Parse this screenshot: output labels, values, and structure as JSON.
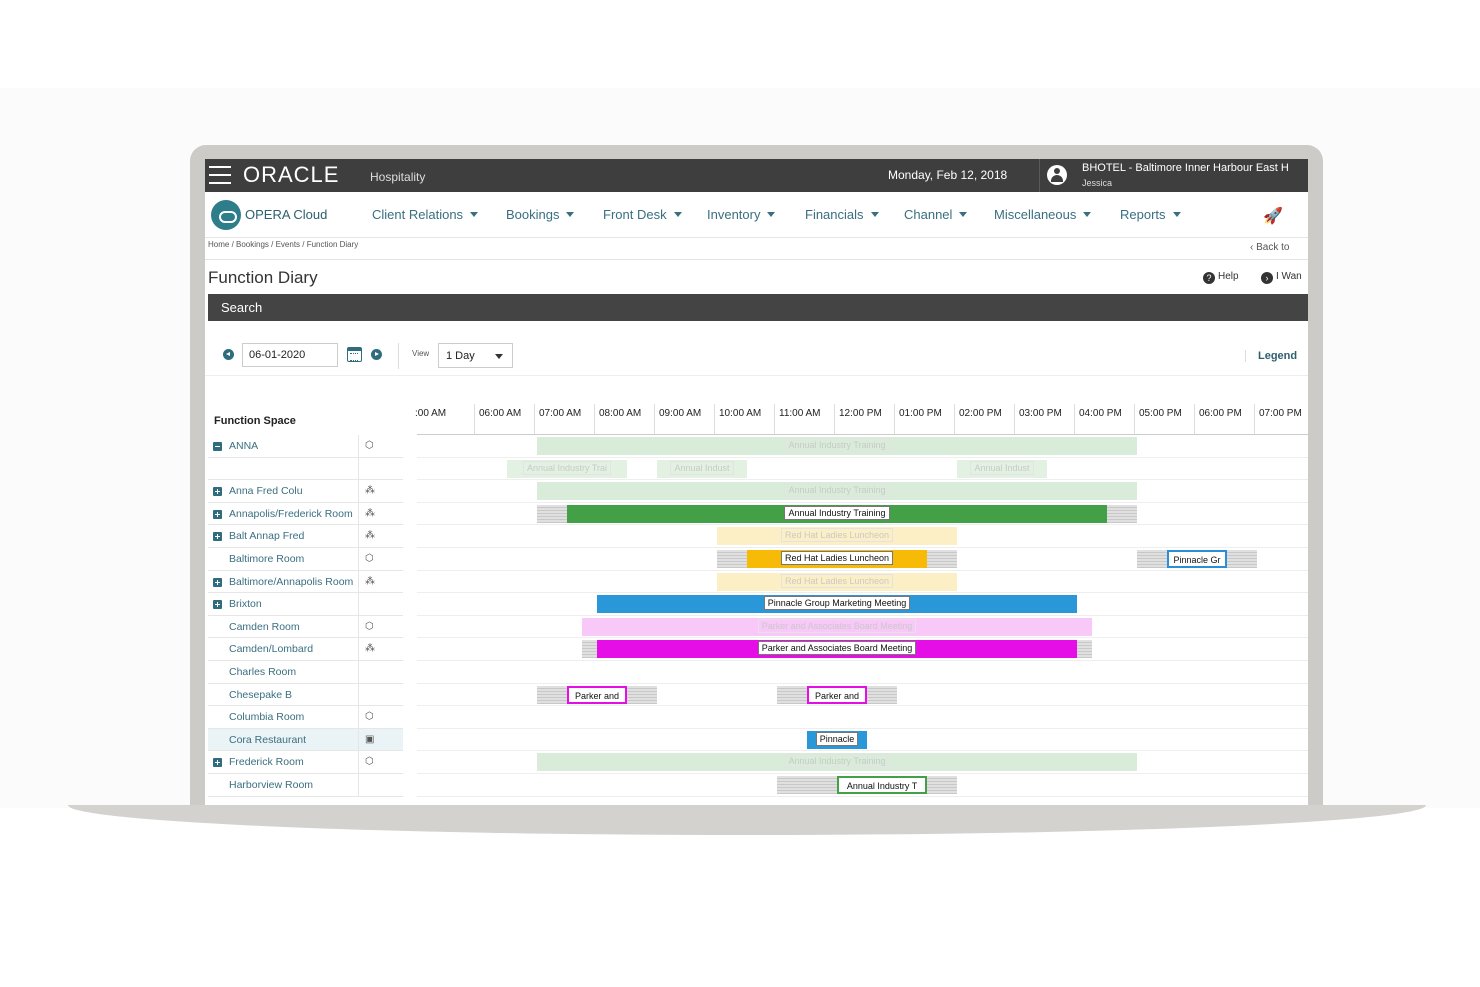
{
  "topbar": {
    "brand": "ORACLE",
    "brand_sub": "Hospitality",
    "date": "Monday, Feb 12, 2018",
    "hotel": "BHOTEL - Baltimore Inner Harbour East H",
    "user": "Jessica"
  },
  "nav": {
    "app": "OPERA Cloud",
    "menus": [
      "Client Relations",
      "Bookings",
      "Front Desk",
      "Inventory",
      "Financials",
      "Channel",
      "Miscellaneous",
      "Reports"
    ]
  },
  "breadcrumb": "Home / Bookings / Events / Function Diary",
  "back_link": "Back to",
  "page": {
    "title": "Function Diary",
    "help": "Help",
    "i_want": "I Wan"
  },
  "search": {
    "label": "Search",
    "date_value": "06-01-2020",
    "view_label": "View",
    "view_value": "1 Day",
    "legend": "Legend"
  },
  "diary": {
    "function_space_header": "Function Space",
    "times": [
      ":00 AM",
      "06:00 AM",
      "07:00 AM",
      "08:00 AM",
      "09:00 AM",
      "10:00 AM",
      "11:00 AM",
      "12:00 PM",
      "01:00 PM",
      "02:00 PM",
      "03:00 PM",
      "04:00 PM",
      "05:00 PM",
      "06:00 PM",
      "07:00 PM"
    ],
    "rooms": [
      {
        "name": "ANNA",
        "expander": "minus",
        "icon": "cube-icon"
      },
      {
        "name": "",
        "expander": "",
        "icon": ""
      },
      {
        "name": "Anna Fred Colu",
        "expander": "plus",
        "icon": "combo-icon"
      },
      {
        "name": "Annapolis/Frederick Room",
        "expander": "plus",
        "icon": "combo-icon"
      },
      {
        "name": "Balt Annap Fred",
        "expander": "plus",
        "icon": "combo-icon"
      },
      {
        "name": "Baltimore Room",
        "expander": "",
        "icon": "cube-icon"
      },
      {
        "name": "Baltimore/Annapolis Room",
        "expander": "plus",
        "icon": "combo-icon"
      },
      {
        "name": "Brixton",
        "expander": "plus",
        "icon": ""
      },
      {
        "name": "Camden Room",
        "expander": "",
        "icon": "cube-icon"
      },
      {
        "name": "Camden/Lombard",
        "expander": "",
        "icon": "combo-icon"
      },
      {
        "name": "Charles Room",
        "expander": "",
        "icon": ""
      },
      {
        "name": "Chesepake B",
        "expander": "",
        "icon": ""
      },
      {
        "name": "Columbia Room",
        "expander": "",
        "icon": "cube-icon"
      },
      {
        "name": "Cora Restaurant",
        "expander": "",
        "icon": "restaurant-icon"
      },
      {
        "name": "Frederick Room",
        "expander": "plus",
        "icon": "cube-icon"
      },
      {
        "name": "Harborview Room",
        "expander": "",
        "icon": ""
      }
    ],
    "events": [
      {
        "row": 0,
        "label": "Annual Industry Training",
        "start": 7.0,
        "end": 17.0,
        "bg": "#d9ecd9",
        "style": "faded"
      },
      {
        "row": 1,
        "label": "Annual Industry Trai",
        "start": 6.5,
        "end": 8.5,
        "bg": "#e3f1e3",
        "style": "faded"
      },
      {
        "row": 1,
        "label": "Annual Indust",
        "start": 9.0,
        "end": 10.5,
        "bg": "#e3f1e3",
        "style": "faded"
      },
      {
        "row": 1,
        "label": "Annual Indust",
        "start": 14.0,
        "end": 15.5,
        "bg": "#e3f1e3",
        "style": "faded"
      },
      {
        "row": 2,
        "label": "Annual Industry Training",
        "start": 7.0,
        "end": 17.0,
        "bg": "#d9ecd9",
        "style": "faded"
      },
      {
        "row": 3,
        "label": "Annual Industry Training",
        "start": 7.5,
        "end": 16.5,
        "bg": "#43a047",
        "style": "solid"
      },
      {
        "row": 4,
        "label": "Red Hat Ladies Luncheon",
        "start": 10.0,
        "end": 14.0,
        "bg": "#fcefc5",
        "style": "faded"
      },
      {
        "row": 5,
        "label": "Red Hat Ladies Luncheon",
        "start": 10.5,
        "end": 13.5,
        "bg": "#f7bb07",
        "style": "solid"
      },
      {
        "row": 5,
        "label": "Pinnacle Gr",
        "start": 17.5,
        "end": 18.5,
        "bg": "#ffffff",
        "style": "solid",
        "border": "#2a8fd6"
      },
      {
        "row": 6,
        "label": "Red Hat Ladies Luncheon",
        "start": 10.0,
        "end": 14.0,
        "bg": "#fcefc5",
        "style": "faded"
      },
      {
        "row": 7,
        "label": "Pinnacle Group Marketing Meeting",
        "start": 8.0,
        "end": 16.0,
        "bg": "#2a98d8",
        "style": "solid"
      },
      {
        "row": 8,
        "label": "Parker and Associates Board Meeting",
        "start": 7.75,
        "end": 16.25,
        "bg": "#f8c8f8",
        "style": "faded"
      },
      {
        "row": 9,
        "label": "Parker and Associates Board Meeting",
        "start": 8.0,
        "end": 16.0,
        "bg": "#e60ee6",
        "style": "solid"
      },
      {
        "row": 11,
        "label": "Parker and",
        "start": 7.5,
        "end": 8.5,
        "bg": "#ffffff",
        "style": "solid",
        "border": "#e60ee6"
      },
      {
        "row": 11,
        "label": "Parker and",
        "start": 11.5,
        "end": 12.5,
        "bg": "#ffffff",
        "style": "solid",
        "border": "#e60ee6"
      },
      {
        "row": 13,
        "label": "Pinnacle",
        "start": 11.5,
        "end": 12.5,
        "bg": "#2a98d8",
        "style": "solid"
      },
      {
        "row": 14,
        "label": "Annual Industry Training",
        "start": 7.0,
        "end": 17.0,
        "bg": "#d9ecd9",
        "style": "faded"
      },
      {
        "row": 15,
        "label": "Annual Industry T",
        "start": 12.0,
        "end": 13.5,
        "bg": "#ffffff",
        "style": "solid",
        "border": "#43a047"
      }
    ],
    "setup_blocks": [
      {
        "row": 3,
        "start": 7.0,
        "end": 7.5
      },
      {
        "row": 3,
        "start": 16.5,
        "end": 17.0
      },
      {
        "row": 5,
        "start": 10.0,
        "end": 10.5
      },
      {
        "row": 5,
        "start": 13.5,
        "end": 14.0
      },
      {
        "row": 5,
        "start": 17.0,
        "end": 17.5
      },
      {
        "row": 5,
        "start": 18.5,
        "end": 19.0
      },
      {
        "row": 9,
        "start": 7.75,
        "end": 8.0
      },
      {
        "row": 9,
        "start": 16.0,
        "end": 16.25
      },
      {
        "row": 11,
        "start": 7.0,
        "end": 7.5
      },
      {
        "row": 11,
        "start": 8.5,
        "end": 9.0
      },
      {
        "row": 11,
        "start": 11.0,
        "end": 11.5
      },
      {
        "row": 11,
        "start": 12.5,
        "end": 13.0
      },
      {
        "row": 15,
        "start": 11.0,
        "end": 12.0
      },
      {
        "row": 15,
        "start": 13.5,
        "end": 14.0
      }
    ]
  }
}
